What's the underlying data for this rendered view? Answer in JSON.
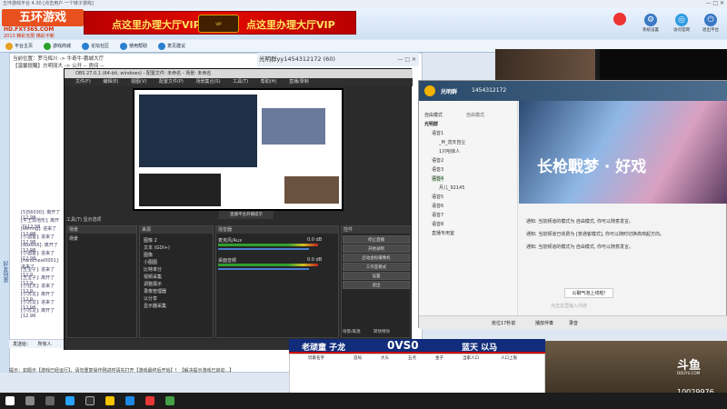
{
  "lobby": {
    "window_title": "五环游戏平台 4.30 [点击用户 一个妹子游戏]",
    "logo_text": "五环游戏",
    "logo_url": "HD.FXT365.COM",
    "logo_slogan": "2013 精彩无限 精彩不断",
    "ad_left": "点这里办理大厅VIP",
    "ad_right": "点这里办理大厅VIP",
    "ad_badge": "VIP",
    "top_icons": [
      {
        "label": "系统设置",
        "icon": "gear-icon",
        "color": "#3a78c4"
      },
      {
        "label": "访问官网",
        "icon": "globe-icon",
        "color": "#2f9be0"
      },
      {
        "label": "退出平台",
        "icon": "exit-icon",
        "color": "#3a78c4"
      }
    ],
    "nav": [
      "平台主页",
      "游戏商城",
      "论坛社区",
      "使用帮助",
      "意见建议"
    ],
    "location_label": "当前位置：罗马辉川 -> 牛奇牛-鹏城大厅",
    "room_notice": "【温馨提醒】方明丽大 -> 公开 -- 房间 --  ",
    "side_tab": "好友列表",
    "chat_lines": [
      "[5]56030]: 离开了[12.98",
      "[平王现地形]: 离开了[12.98",
      "[Wining]: 进来了[12.98",
      "[小酒客]: 进来了[12.98",
      "[dox666]: 离开了[12.98",
      "[小酒客]: 进来了[12.98",
      "[haiucheal0001]: 进来了",
      "[五宝子]: 进来了[12.9",
      "[五宝子]: 离开了[12.9",
      "[小狂天]: 进来了[12.9",
      "[小苏龙]: 离开了[12.9",
      "[小苏龙]: 进来了[12.98",
      "[小苏龙]: 离开了[12.98"
    ],
    "input_label": "发送给：",
    "input_value": "所有人",
    "tip": "提示：如题示【游戏已经运行】，请勿重复操作刚进时请先打开【游戏最终后开始】！【解决提示游戏已启动...】"
  },
  "obs": {
    "title": "OBS 27.0.1 (64-bit, windows) - 配置文件: 未命名 - 场景: 未命名",
    "menu": [
      "文件(F)",
      "编辑(E)",
      "视图(V)",
      "配置文件(P)",
      "场景集合(S)",
      "工具(T)",
      "帮助(H)",
      "直播/录制"
    ],
    "scenes_title": "场景",
    "sources_title": "来源",
    "mixer_title": "混音器",
    "controls_title": "控件",
    "scene_name": "场景",
    "sources": [
      "图像 2",
      "文本 (GDI+)",
      "图像",
      "小图图",
      "比特率分",
      "视频采集",
      "调整展示",
      "录像管理器",
      "以分享",
      "显示器采集"
    ],
    "mixer": [
      {
        "name": "麦克风/Aux",
        "db": "0.0 dB"
      },
      {
        "name": "桌面音频",
        "db": "0.0 dB"
      }
    ],
    "controls": [
      "停止直播",
      "开始录制",
      "启动虚拟摄像机",
      "工作室模式",
      "设置",
      "退出"
    ],
    "tab_scenes": "场景/来源",
    "tab_transitions": "转场特效",
    "status": "LIVE: 00:12:34   REC: 00:00:00   CPU: 12.8%, 30.00 fps",
    "transition_label": "工具(T)   显示选项"
  },
  "overlay": {
    "title": "光明群yy1454312172 (60)",
    "popup": "直播平台开播提示"
  },
  "qq": {
    "group_name": "光明群",
    "group_id": "1454312172",
    "mode_left": "自由模式",
    "mode_right": "自由模式",
    "tree": [
      "光明群",
      "语音1",
      "_M_流天自尘",
      "1只哈妹人",
      "语音2",
      "语音3",
      "语音4",
      "月儿_92145",
      "语音5",
      "语音6",
      "语音7",
      "语音8",
      "直播专用室"
    ],
    "banner_text": "长枪戰梦 · 好戏",
    "messages": [
      "通知: 当前频道的模式为 自由模式, 你可以随意发言。",
      "通知: 当前频道已收费为 [普通客模式], 你可以随时切换高响起方向。",
      "通知: 当前频道的模式为 自由模式, 你可以随意发言。"
    ],
    "action_button": "公聊气泡上线啦!",
    "input_placeholder": "点击这里输入内容",
    "bottom_items": [
      "抢位17秒前",
      "播放伴奏",
      "录音"
    ]
  },
  "stream": {
    "score_left": "老顽童  子龙",
    "score_mid": "0VS0",
    "score_right": "蓝天  以马",
    "sheet_headers": [
      "玩家名字",
      "首局",
      "大头",
      "五点",
      "金子",
      "当家人口",
      "人口上限"
    ],
    "douyu": "斗鱼",
    "douyu_url": "DOUYU.COM",
    "room_id": "10029976"
  },
  "taskbar": {
    "icons": [
      "start-icon",
      "search-icon",
      "task-view-icon",
      "qq-icon",
      "obs-icon",
      "explorer-icon",
      "ie-icon",
      "game-icon",
      "wechat-icon"
    ]
  }
}
